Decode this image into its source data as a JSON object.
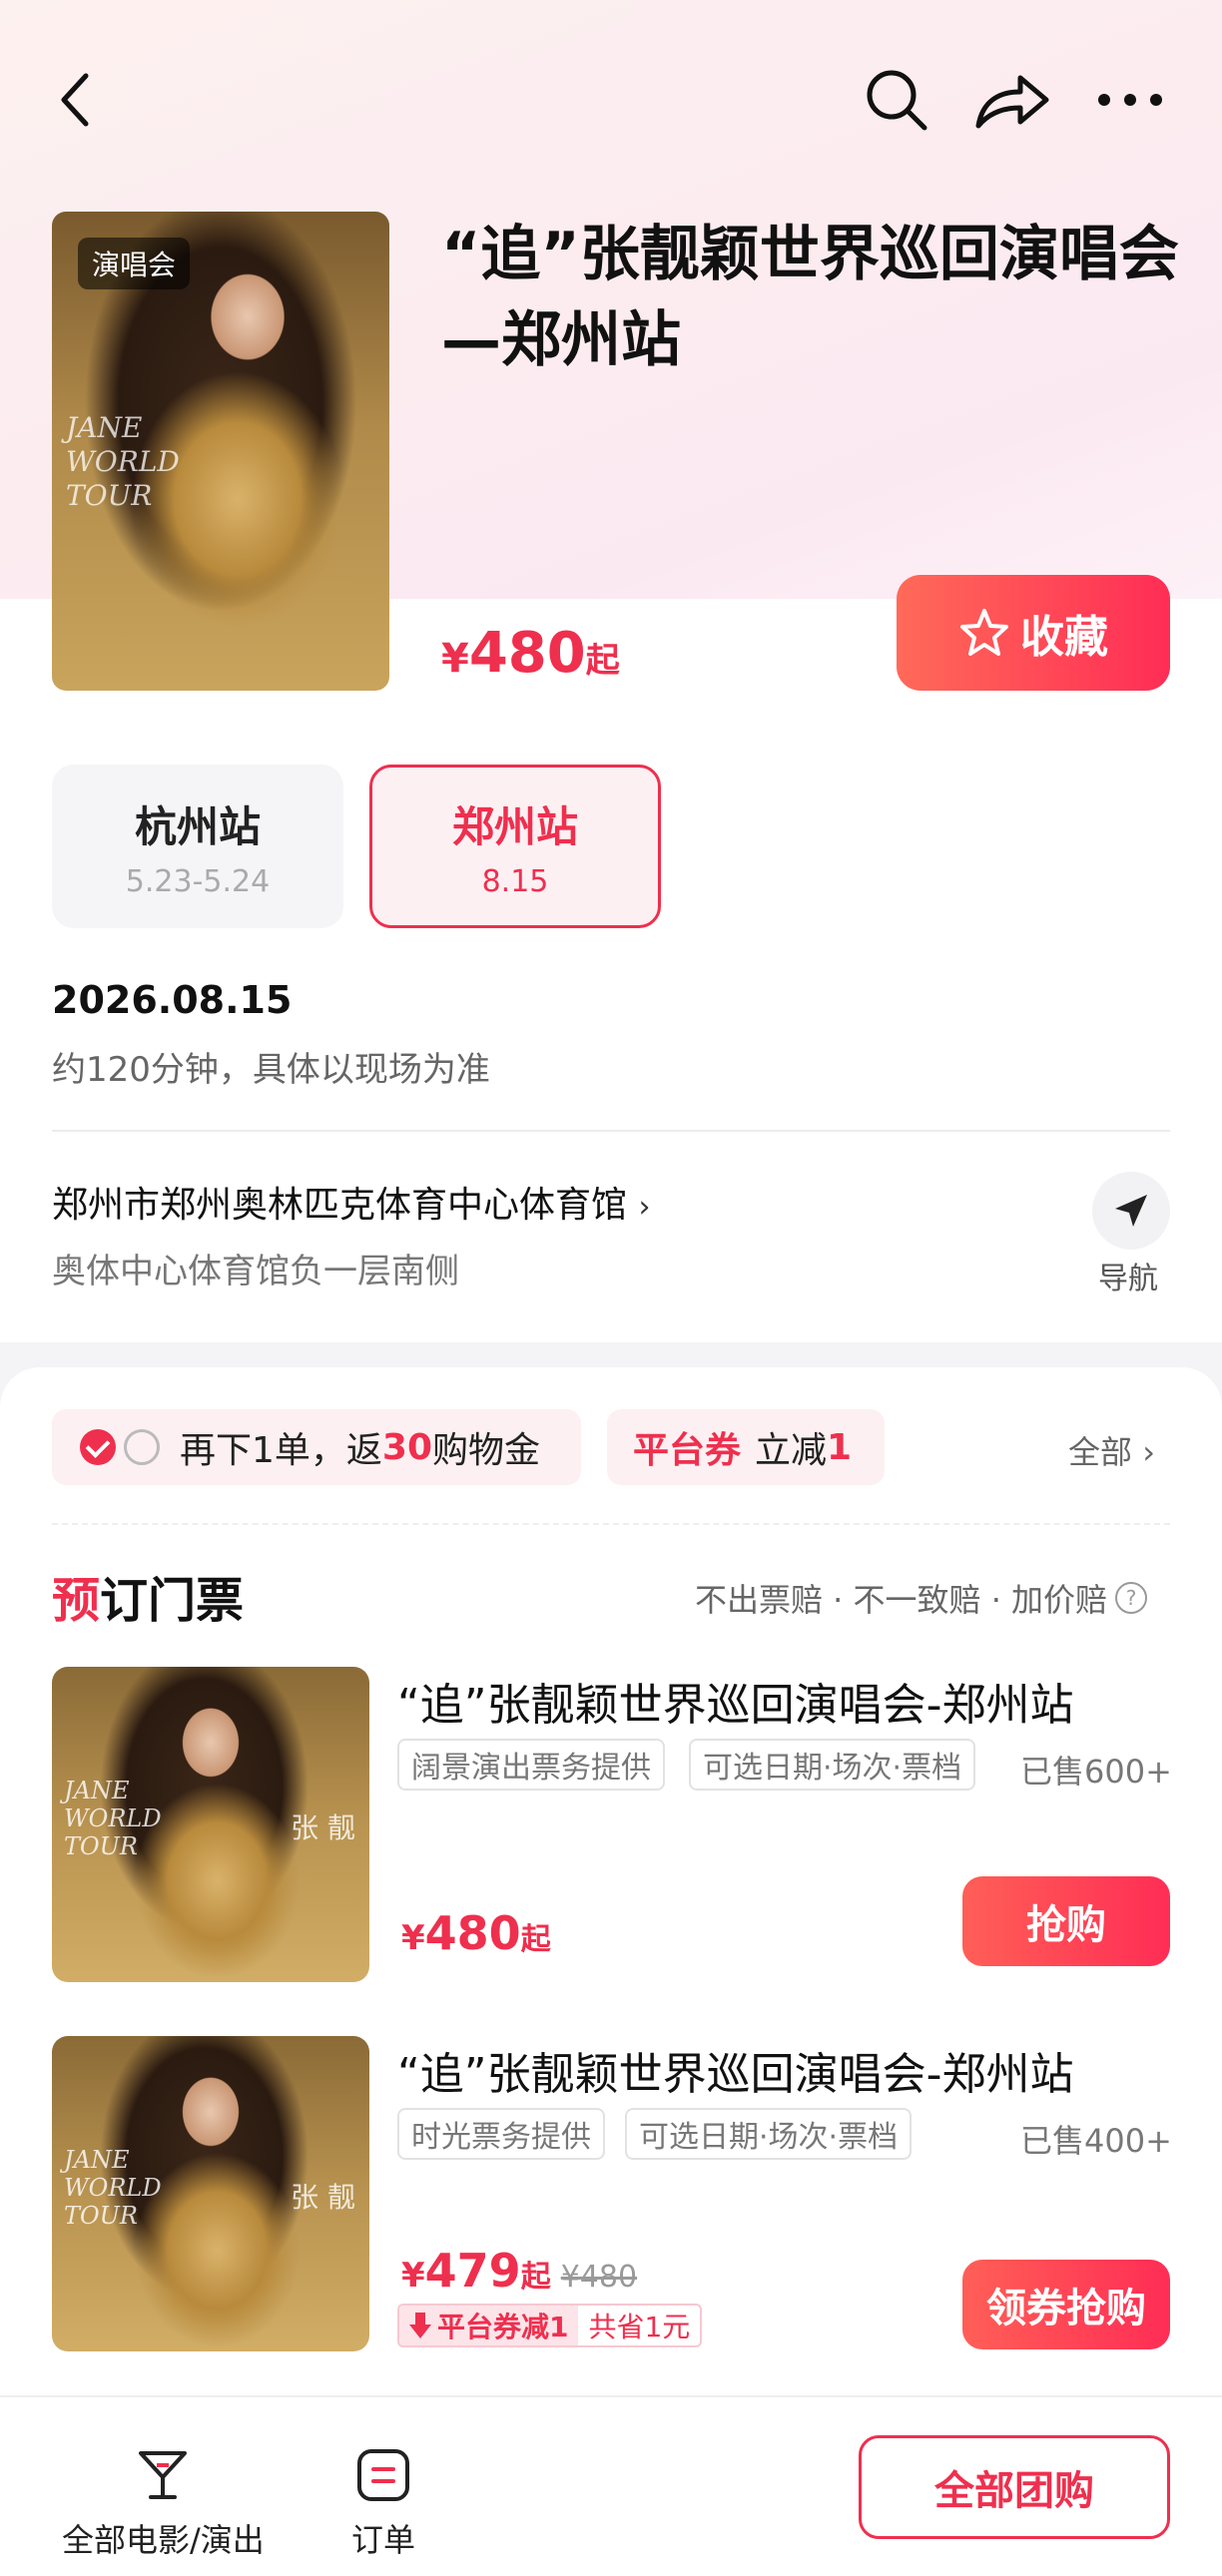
{
  "header": {
    "back_icon": "chevron-left-icon",
    "search_icon": "search-icon",
    "share_icon": "share-icon",
    "more_icon": "more-icon"
  },
  "event": {
    "category_tag": "演唱会",
    "title": "“追”张靓颖世界巡回演唱会—郑州站",
    "price_currency": "¥",
    "price_value": "480",
    "price_suffix": "起",
    "favorite_label": "收藏",
    "poster_text": "JANE\nWORLD\nTOUR"
  },
  "stations": [
    {
      "name": "杭州站",
      "dates": "5.23-5.24",
      "selected": false
    },
    {
      "name": "郑州站",
      "dates": "8.15",
      "selected": true
    }
  ],
  "schedule": {
    "date": "2026.08.15",
    "duration": "约120分钟，具体以现场为准"
  },
  "venue": {
    "name": "郑州市郑州奥林匹克体育中心体育馆",
    "sub": "奥体中心体育馆负一层南侧",
    "navigate_label": "导航"
  },
  "promos": {
    "cashback_prefix": "再下1单，返",
    "cashback_amount": "30",
    "cashback_suffix": "购物金",
    "platform_coupon_label": "平台券",
    "platform_coupon_prefix": "立减",
    "platform_coupon_amount": "1",
    "all_label": "全部"
  },
  "booking": {
    "section_title_first": "预",
    "section_title_rest": "订门票",
    "guarantees": "不出票赔 · 不一致赔 · 加价赔"
  },
  "items": [
    {
      "title": "“追”张靓颖世界巡回演唱会-郑州站",
      "provider": "阔景演出票务提供",
      "options": "可选日期·场次·票档",
      "sold": "已售600+",
      "currency": "¥",
      "price": "480",
      "suffix": "起",
      "button": "抢购"
    },
    {
      "title": "“追”张靓颖世界巡回演唱会-郑州站",
      "provider": "时光票务提供",
      "options": "可选日期·场次·票档",
      "sold": "已售400+",
      "currency": "¥",
      "price": "479",
      "suffix": "起",
      "old_price": "¥480",
      "coupon_a": "平台券减1",
      "coupon_b": "共省1元",
      "button": "领券抢购"
    }
  ],
  "bottom_bar": {
    "tab1_label": "全部电影/演出",
    "tab2_label": "订单",
    "group_button": "全部团购"
  },
  "colors": {
    "accent": "#ef2f4e",
    "button_gradient_start": "#ff6a59",
    "button_gradient_end": "#ff2d55"
  }
}
